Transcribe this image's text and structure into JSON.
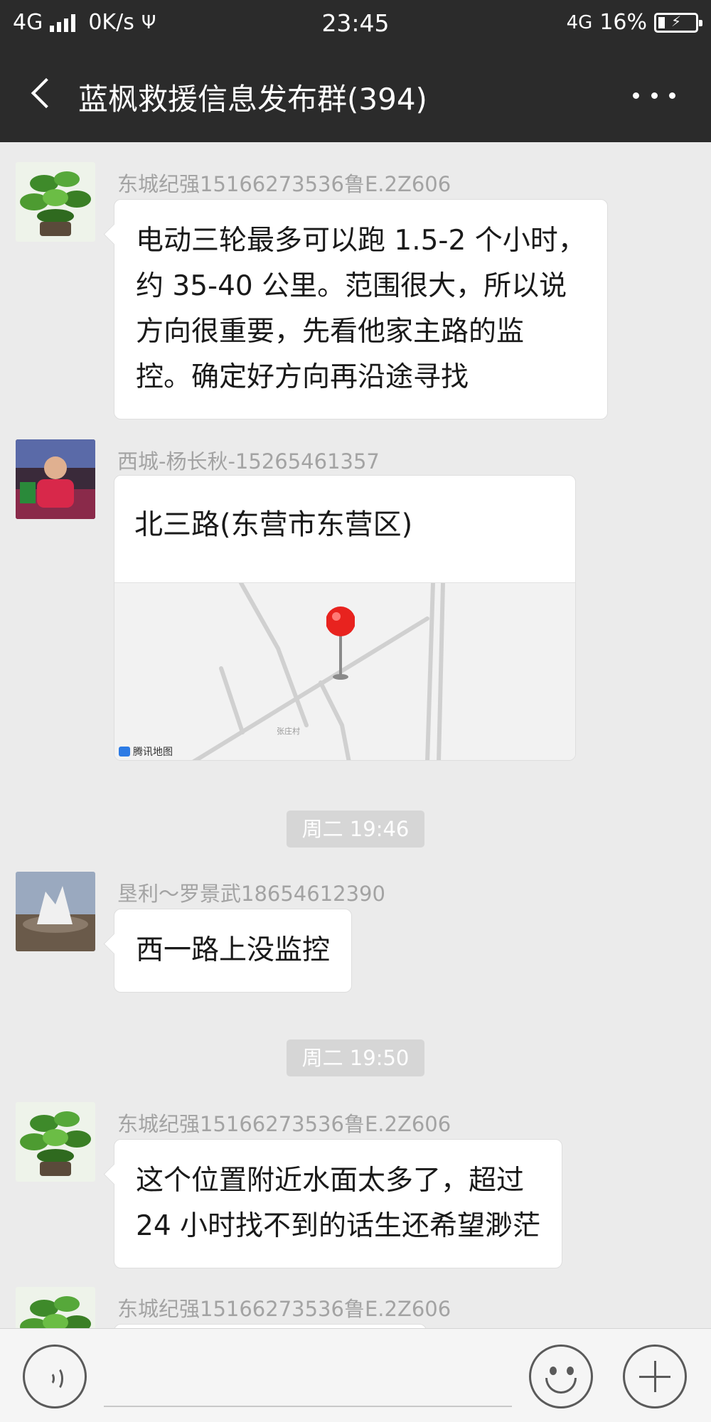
{
  "status_bar": {
    "network_left": "4G",
    "speed": "0K/s",
    "time": "23:45",
    "network_right": "4G",
    "battery": "16%"
  },
  "header": {
    "title": "蓝枫救援信息发布群(394)"
  },
  "messages": [
    {
      "sender": "东城纪强15166273536鲁E.2Z606",
      "lines": [
        "电动三轮最多可以跑 1.5-2 个小时，",
        "约 35-40 公里。范围很大，所以说",
        "方向很重要，先看他家主路的监",
        "控。确定好方向再沿途寻找"
      ]
    },
    {
      "sender": "西城-杨长秋-15265461357",
      "location_title": "北三路(东营市东营区)",
      "map_brand": "腾讯地图",
      "map_label": "张庄村"
    },
    {
      "sender": "垦利～罗景武18654612390",
      "lines": [
        "西一路上没监控"
      ]
    },
    {
      "sender": "东城纪强15166273536鲁E.2Z606",
      "lines": [
        "这个位置附近水面太多了，超过",
        "24 小时找不到的话生还希望渺茫"
      ]
    },
    {
      "sender": "东城纪强15166273536鲁E.2Z606"
    }
  ],
  "timestamps": [
    "周二 19:46",
    "周二 19:50"
  ],
  "icons": {
    "back": "back-arrow-icon",
    "more": "more-dots-icon",
    "voice": "voice-icon",
    "emoji": "emoji-icon",
    "plus": "plus-icon"
  },
  "colors": {
    "bar": "#2b2b2b",
    "background": "#ebebeb",
    "bubble": "#ffffff",
    "pin": "#e8231f"
  }
}
